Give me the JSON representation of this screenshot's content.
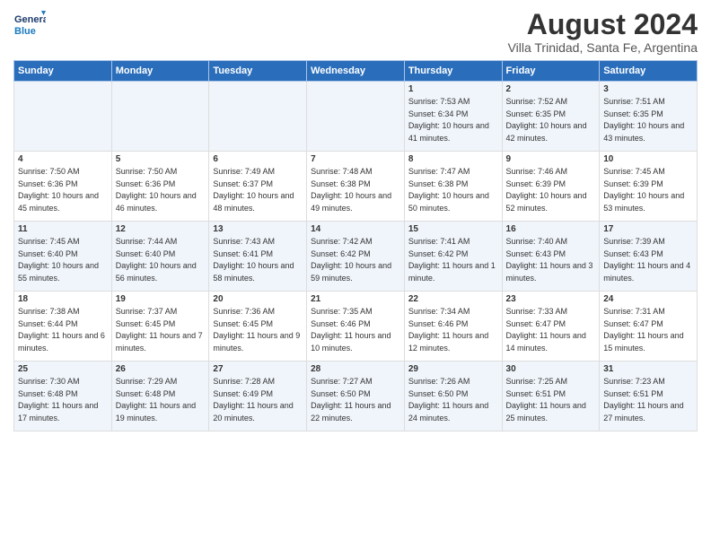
{
  "header": {
    "logo_line1": "General",
    "logo_line2": "Blue",
    "title": "August 2024",
    "subtitle": "Villa Trinidad, Santa Fe, Argentina"
  },
  "columns": [
    "Sunday",
    "Monday",
    "Tuesday",
    "Wednesday",
    "Thursday",
    "Friday",
    "Saturday"
  ],
  "weeks": [
    [
      {
        "day": "",
        "info": ""
      },
      {
        "day": "",
        "info": ""
      },
      {
        "day": "",
        "info": ""
      },
      {
        "day": "",
        "info": ""
      },
      {
        "day": "1",
        "info": "Sunrise: 7:53 AM\nSunset: 6:34 PM\nDaylight: 10 hours and 41 minutes."
      },
      {
        "day": "2",
        "info": "Sunrise: 7:52 AM\nSunset: 6:35 PM\nDaylight: 10 hours and 42 minutes."
      },
      {
        "day": "3",
        "info": "Sunrise: 7:51 AM\nSunset: 6:35 PM\nDaylight: 10 hours and 43 minutes."
      }
    ],
    [
      {
        "day": "4",
        "info": "Sunrise: 7:50 AM\nSunset: 6:36 PM\nDaylight: 10 hours and 45 minutes."
      },
      {
        "day": "5",
        "info": "Sunrise: 7:50 AM\nSunset: 6:36 PM\nDaylight: 10 hours and 46 minutes."
      },
      {
        "day": "6",
        "info": "Sunrise: 7:49 AM\nSunset: 6:37 PM\nDaylight: 10 hours and 48 minutes."
      },
      {
        "day": "7",
        "info": "Sunrise: 7:48 AM\nSunset: 6:38 PM\nDaylight: 10 hours and 49 minutes."
      },
      {
        "day": "8",
        "info": "Sunrise: 7:47 AM\nSunset: 6:38 PM\nDaylight: 10 hours and 50 minutes."
      },
      {
        "day": "9",
        "info": "Sunrise: 7:46 AM\nSunset: 6:39 PM\nDaylight: 10 hours and 52 minutes."
      },
      {
        "day": "10",
        "info": "Sunrise: 7:45 AM\nSunset: 6:39 PM\nDaylight: 10 hours and 53 minutes."
      }
    ],
    [
      {
        "day": "11",
        "info": "Sunrise: 7:45 AM\nSunset: 6:40 PM\nDaylight: 10 hours and 55 minutes."
      },
      {
        "day": "12",
        "info": "Sunrise: 7:44 AM\nSunset: 6:40 PM\nDaylight: 10 hours and 56 minutes."
      },
      {
        "day": "13",
        "info": "Sunrise: 7:43 AM\nSunset: 6:41 PM\nDaylight: 10 hours and 58 minutes."
      },
      {
        "day": "14",
        "info": "Sunrise: 7:42 AM\nSunset: 6:42 PM\nDaylight: 10 hours and 59 minutes."
      },
      {
        "day": "15",
        "info": "Sunrise: 7:41 AM\nSunset: 6:42 PM\nDaylight: 11 hours and 1 minute."
      },
      {
        "day": "16",
        "info": "Sunrise: 7:40 AM\nSunset: 6:43 PM\nDaylight: 11 hours and 3 minutes."
      },
      {
        "day": "17",
        "info": "Sunrise: 7:39 AM\nSunset: 6:43 PM\nDaylight: 11 hours and 4 minutes."
      }
    ],
    [
      {
        "day": "18",
        "info": "Sunrise: 7:38 AM\nSunset: 6:44 PM\nDaylight: 11 hours and 6 minutes."
      },
      {
        "day": "19",
        "info": "Sunrise: 7:37 AM\nSunset: 6:45 PM\nDaylight: 11 hours and 7 minutes."
      },
      {
        "day": "20",
        "info": "Sunrise: 7:36 AM\nSunset: 6:45 PM\nDaylight: 11 hours and 9 minutes."
      },
      {
        "day": "21",
        "info": "Sunrise: 7:35 AM\nSunset: 6:46 PM\nDaylight: 11 hours and 10 minutes."
      },
      {
        "day": "22",
        "info": "Sunrise: 7:34 AM\nSunset: 6:46 PM\nDaylight: 11 hours and 12 minutes."
      },
      {
        "day": "23",
        "info": "Sunrise: 7:33 AM\nSunset: 6:47 PM\nDaylight: 11 hours and 14 minutes."
      },
      {
        "day": "24",
        "info": "Sunrise: 7:31 AM\nSunset: 6:47 PM\nDaylight: 11 hours and 15 minutes."
      }
    ],
    [
      {
        "day": "25",
        "info": "Sunrise: 7:30 AM\nSunset: 6:48 PM\nDaylight: 11 hours and 17 minutes."
      },
      {
        "day": "26",
        "info": "Sunrise: 7:29 AM\nSunset: 6:48 PM\nDaylight: 11 hours and 19 minutes."
      },
      {
        "day": "27",
        "info": "Sunrise: 7:28 AM\nSunset: 6:49 PM\nDaylight: 11 hours and 20 minutes."
      },
      {
        "day": "28",
        "info": "Sunrise: 7:27 AM\nSunset: 6:50 PM\nDaylight: 11 hours and 22 minutes."
      },
      {
        "day": "29",
        "info": "Sunrise: 7:26 AM\nSunset: 6:50 PM\nDaylight: 11 hours and 24 minutes."
      },
      {
        "day": "30",
        "info": "Sunrise: 7:25 AM\nSunset: 6:51 PM\nDaylight: 11 hours and 25 minutes."
      },
      {
        "day": "31",
        "info": "Sunrise: 7:23 AM\nSunset: 6:51 PM\nDaylight: 11 hours and 27 minutes."
      }
    ]
  ]
}
